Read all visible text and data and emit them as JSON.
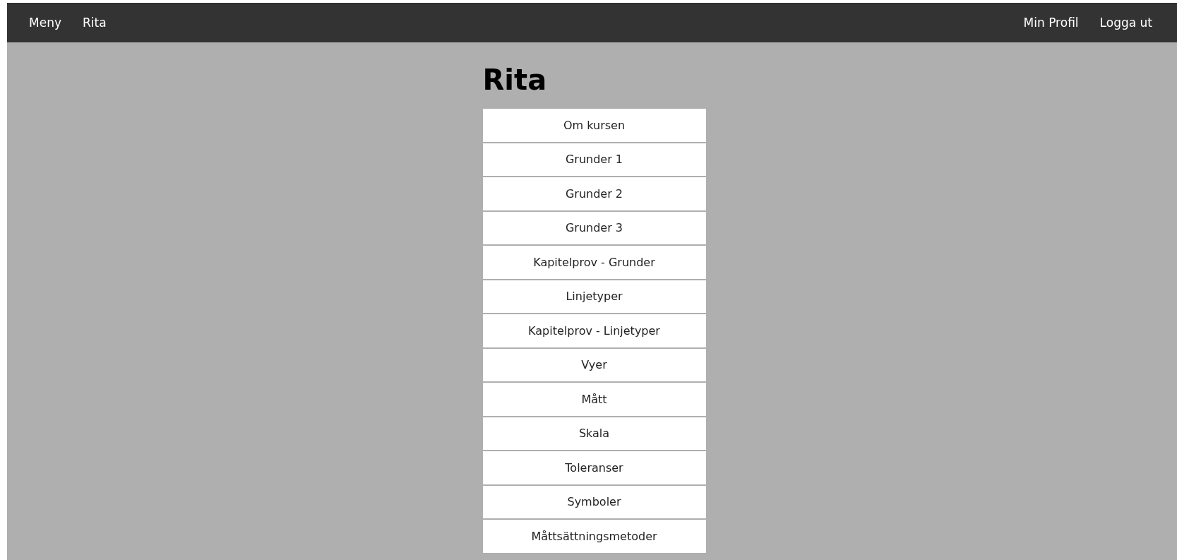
{
  "navbar": {
    "left": [
      "Meny",
      "Rita"
    ],
    "right": [
      "Min Profil",
      "Logga ut"
    ]
  },
  "page": {
    "title": "Rita",
    "items": [
      "Om kursen",
      "Grunder 1",
      "Grunder 2",
      "Grunder 3",
      "Kapitelprov - Grunder",
      "Linjetyper",
      "Kapitelprov - Linjetyper",
      "Vyer",
      "Mått",
      "Skala",
      "Toleranser",
      "Symboler",
      "Måttsättningsmetoder"
    ]
  }
}
